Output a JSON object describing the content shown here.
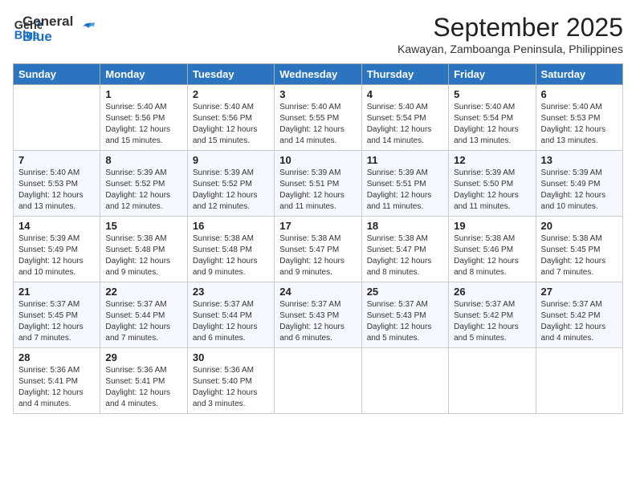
{
  "header": {
    "logo_line1": "General",
    "logo_line2": "Blue",
    "month_title": "September 2025",
    "location": "Kawayan, Zamboanga Peninsula, Philippines"
  },
  "days_of_week": [
    "Sunday",
    "Monday",
    "Tuesday",
    "Wednesday",
    "Thursday",
    "Friday",
    "Saturday"
  ],
  "weeks": [
    [
      {
        "day": "",
        "info": ""
      },
      {
        "day": "1",
        "info": "Sunrise: 5:40 AM\nSunset: 5:56 PM\nDaylight: 12 hours\nand 15 minutes."
      },
      {
        "day": "2",
        "info": "Sunrise: 5:40 AM\nSunset: 5:56 PM\nDaylight: 12 hours\nand 15 minutes."
      },
      {
        "day": "3",
        "info": "Sunrise: 5:40 AM\nSunset: 5:55 PM\nDaylight: 12 hours\nand 14 minutes."
      },
      {
        "day": "4",
        "info": "Sunrise: 5:40 AM\nSunset: 5:54 PM\nDaylight: 12 hours\nand 14 minutes."
      },
      {
        "day": "5",
        "info": "Sunrise: 5:40 AM\nSunset: 5:54 PM\nDaylight: 12 hours\nand 13 minutes."
      },
      {
        "day": "6",
        "info": "Sunrise: 5:40 AM\nSunset: 5:53 PM\nDaylight: 12 hours\nand 13 minutes."
      }
    ],
    [
      {
        "day": "7",
        "info": "Sunrise: 5:40 AM\nSunset: 5:53 PM\nDaylight: 12 hours\nand 13 minutes."
      },
      {
        "day": "8",
        "info": "Sunrise: 5:39 AM\nSunset: 5:52 PM\nDaylight: 12 hours\nand 12 minutes."
      },
      {
        "day": "9",
        "info": "Sunrise: 5:39 AM\nSunset: 5:52 PM\nDaylight: 12 hours\nand 12 minutes."
      },
      {
        "day": "10",
        "info": "Sunrise: 5:39 AM\nSunset: 5:51 PM\nDaylight: 12 hours\nand 11 minutes."
      },
      {
        "day": "11",
        "info": "Sunrise: 5:39 AM\nSunset: 5:51 PM\nDaylight: 12 hours\nand 11 minutes."
      },
      {
        "day": "12",
        "info": "Sunrise: 5:39 AM\nSunset: 5:50 PM\nDaylight: 12 hours\nand 11 minutes."
      },
      {
        "day": "13",
        "info": "Sunrise: 5:39 AM\nSunset: 5:49 PM\nDaylight: 12 hours\nand 10 minutes."
      }
    ],
    [
      {
        "day": "14",
        "info": "Sunrise: 5:39 AM\nSunset: 5:49 PM\nDaylight: 12 hours\nand 10 minutes."
      },
      {
        "day": "15",
        "info": "Sunrise: 5:38 AM\nSunset: 5:48 PM\nDaylight: 12 hours\nand 9 minutes."
      },
      {
        "day": "16",
        "info": "Sunrise: 5:38 AM\nSunset: 5:48 PM\nDaylight: 12 hours\nand 9 minutes."
      },
      {
        "day": "17",
        "info": "Sunrise: 5:38 AM\nSunset: 5:47 PM\nDaylight: 12 hours\nand 9 minutes."
      },
      {
        "day": "18",
        "info": "Sunrise: 5:38 AM\nSunset: 5:47 PM\nDaylight: 12 hours\nand 8 minutes."
      },
      {
        "day": "19",
        "info": "Sunrise: 5:38 AM\nSunset: 5:46 PM\nDaylight: 12 hours\nand 8 minutes."
      },
      {
        "day": "20",
        "info": "Sunrise: 5:38 AM\nSunset: 5:45 PM\nDaylight: 12 hours\nand 7 minutes."
      }
    ],
    [
      {
        "day": "21",
        "info": "Sunrise: 5:37 AM\nSunset: 5:45 PM\nDaylight: 12 hours\nand 7 minutes."
      },
      {
        "day": "22",
        "info": "Sunrise: 5:37 AM\nSunset: 5:44 PM\nDaylight: 12 hours\nand 7 minutes."
      },
      {
        "day": "23",
        "info": "Sunrise: 5:37 AM\nSunset: 5:44 PM\nDaylight: 12 hours\nand 6 minutes."
      },
      {
        "day": "24",
        "info": "Sunrise: 5:37 AM\nSunset: 5:43 PM\nDaylight: 12 hours\nand 6 minutes."
      },
      {
        "day": "25",
        "info": "Sunrise: 5:37 AM\nSunset: 5:43 PM\nDaylight: 12 hours\nand 5 minutes."
      },
      {
        "day": "26",
        "info": "Sunrise: 5:37 AM\nSunset: 5:42 PM\nDaylight: 12 hours\nand 5 minutes."
      },
      {
        "day": "27",
        "info": "Sunrise: 5:37 AM\nSunset: 5:42 PM\nDaylight: 12 hours\nand 4 minutes."
      }
    ],
    [
      {
        "day": "28",
        "info": "Sunrise: 5:36 AM\nSunset: 5:41 PM\nDaylight: 12 hours\nand 4 minutes."
      },
      {
        "day": "29",
        "info": "Sunrise: 5:36 AM\nSunset: 5:41 PM\nDaylight: 12 hours\nand 4 minutes."
      },
      {
        "day": "30",
        "info": "Sunrise: 5:36 AM\nSunset: 5:40 PM\nDaylight: 12 hours\nand 3 minutes."
      },
      {
        "day": "",
        "info": ""
      },
      {
        "day": "",
        "info": ""
      },
      {
        "day": "",
        "info": ""
      },
      {
        "day": "",
        "info": ""
      }
    ]
  ]
}
